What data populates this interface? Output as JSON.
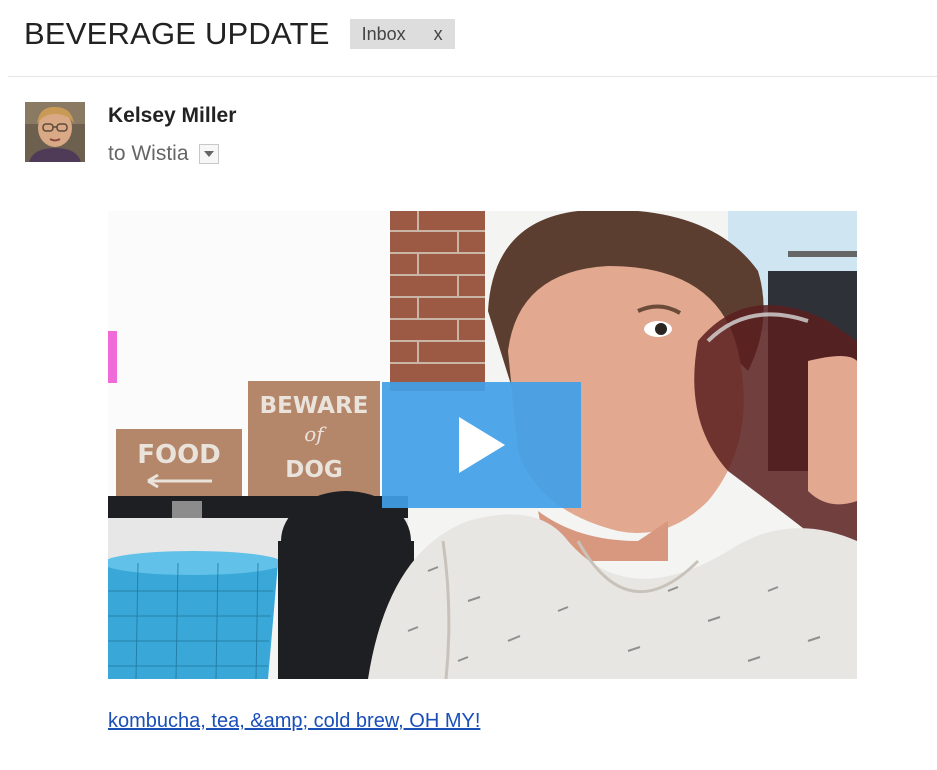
{
  "message": {
    "subject": "BEVERAGE UPDATE",
    "label": {
      "name": "Inbox",
      "remove_glyph": "x"
    }
  },
  "sender": {
    "name": "Kelsey Miller",
    "recipient_line": "to Wistia",
    "avatar_icon": "profile-photo",
    "details_icon": "chevron-down-icon"
  },
  "video": {
    "thumbnail_icon": "video-thumbnail",
    "play_icon": "play-icon",
    "play_color": "#40a0e8",
    "signs": {
      "food": "FOOD",
      "beware": "BEWARE",
      "of": "of",
      "dog": "DOG"
    },
    "link_text": "kombucha, tea, &amp; cold brew, OH MY!",
    "link_color": "#1a4fb8"
  }
}
